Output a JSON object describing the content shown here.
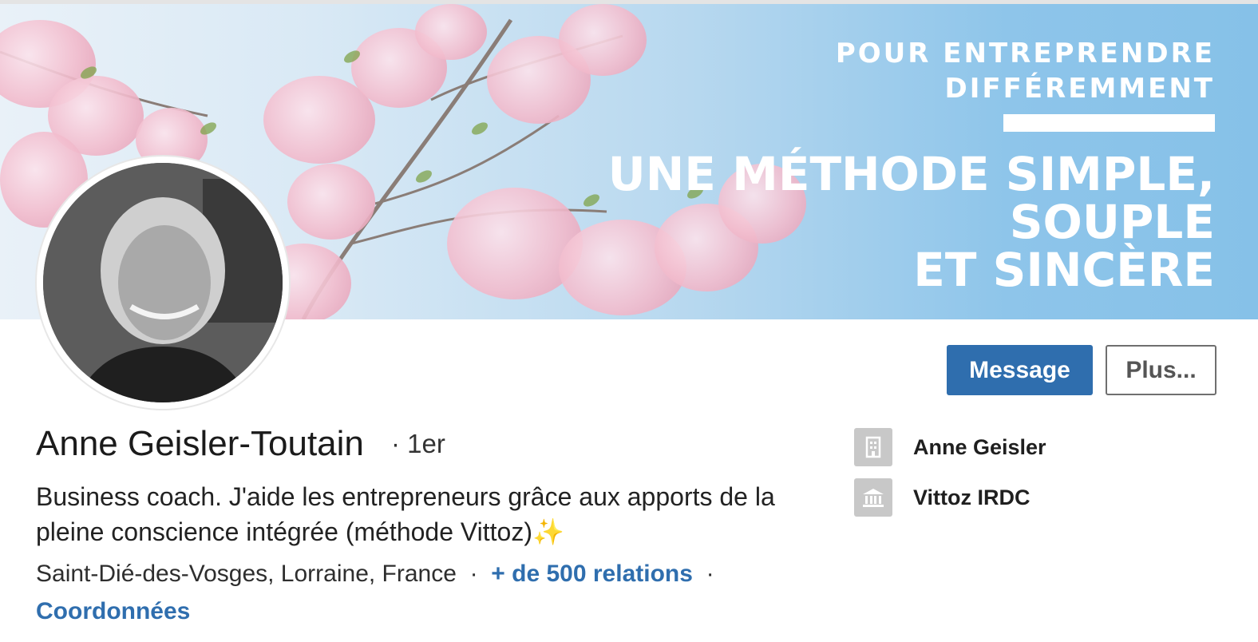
{
  "banner": {
    "line1": "POUR ENTREPRENDRE",
    "line2": "DIFFÉREMMENT",
    "line3": "UNE MÉTHODE SIMPLE,",
    "line4": "SOUPLE",
    "line5": "ET SINCÈRE"
  },
  "profile": {
    "name": "Anne Geisler-Toutain",
    "degree": "1er",
    "headline": "Business coach. J'aide les entrepreneurs grâce aux apports de la pleine conscience intégrée (méthode Vittoz)✨",
    "location": "Saint-Dié-des-Vosges, Lorraine, France",
    "relations": "+ de 500 relations",
    "contact": "Coordonnées"
  },
  "actions": {
    "message_label": "Message",
    "more_label": "Plus..."
  },
  "sidebar": {
    "items": [
      {
        "label": "Anne Geisler",
        "icon": "company-icon"
      },
      {
        "label": "Vittoz IRDC",
        "icon": "school-icon"
      }
    ]
  },
  "colors": {
    "accent": "#2f6eae",
    "banner_sky": "#86c1e8",
    "blossom": "#f2bccd"
  }
}
